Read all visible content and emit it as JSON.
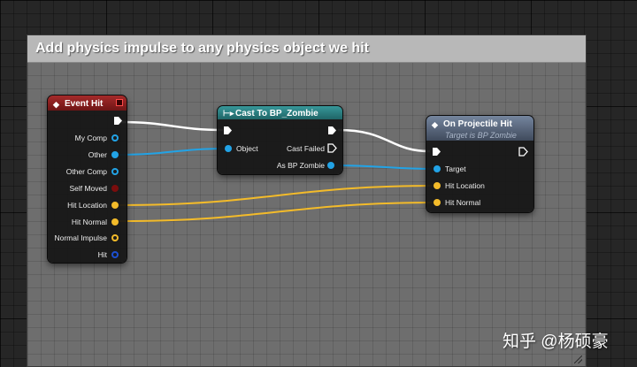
{
  "comment": {
    "title": "Add physics impulse to any physics object we hit"
  },
  "nodes": {
    "event_hit": {
      "title": "Event Hit",
      "header_color": "#8a1f1f",
      "pins": [
        "My Comp",
        "Other",
        "Other Comp",
        "Self Moved",
        "Hit Location",
        "Hit Normal",
        "Normal Impulse",
        "Hit"
      ]
    },
    "cast": {
      "title": "Cast To BP_Zombie",
      "header_color": "#2a7d7f",
      "input_pin": "Object",
      "output_pins": [
        "Cast Failed",
        "As BP Zombie"
      ]
    },
    "on_projectile_hit": {
      "title": "On Projectile Hit",
      "subtitle": "Target is BP Zombie",
      "header_color": "#5a6880",
      "pins": [
        "Target",
        "Hit Location",
        "Hit Normal"
      ]
    }
  },
  "colors": {
    "exec_wire": "#ffffff",
    "object_wire": "#22a3e6",
    "vector_wire": "#f3bb2a"
  },
  "icons": {
    "event": "diamond-event-icon",
    "cast": "cast-arrow-icon",
    "function": "function-diamond-icon",
    "close": "red-square-icon"
  },
  "watermark": "知乎 @杨硕豪"
}
